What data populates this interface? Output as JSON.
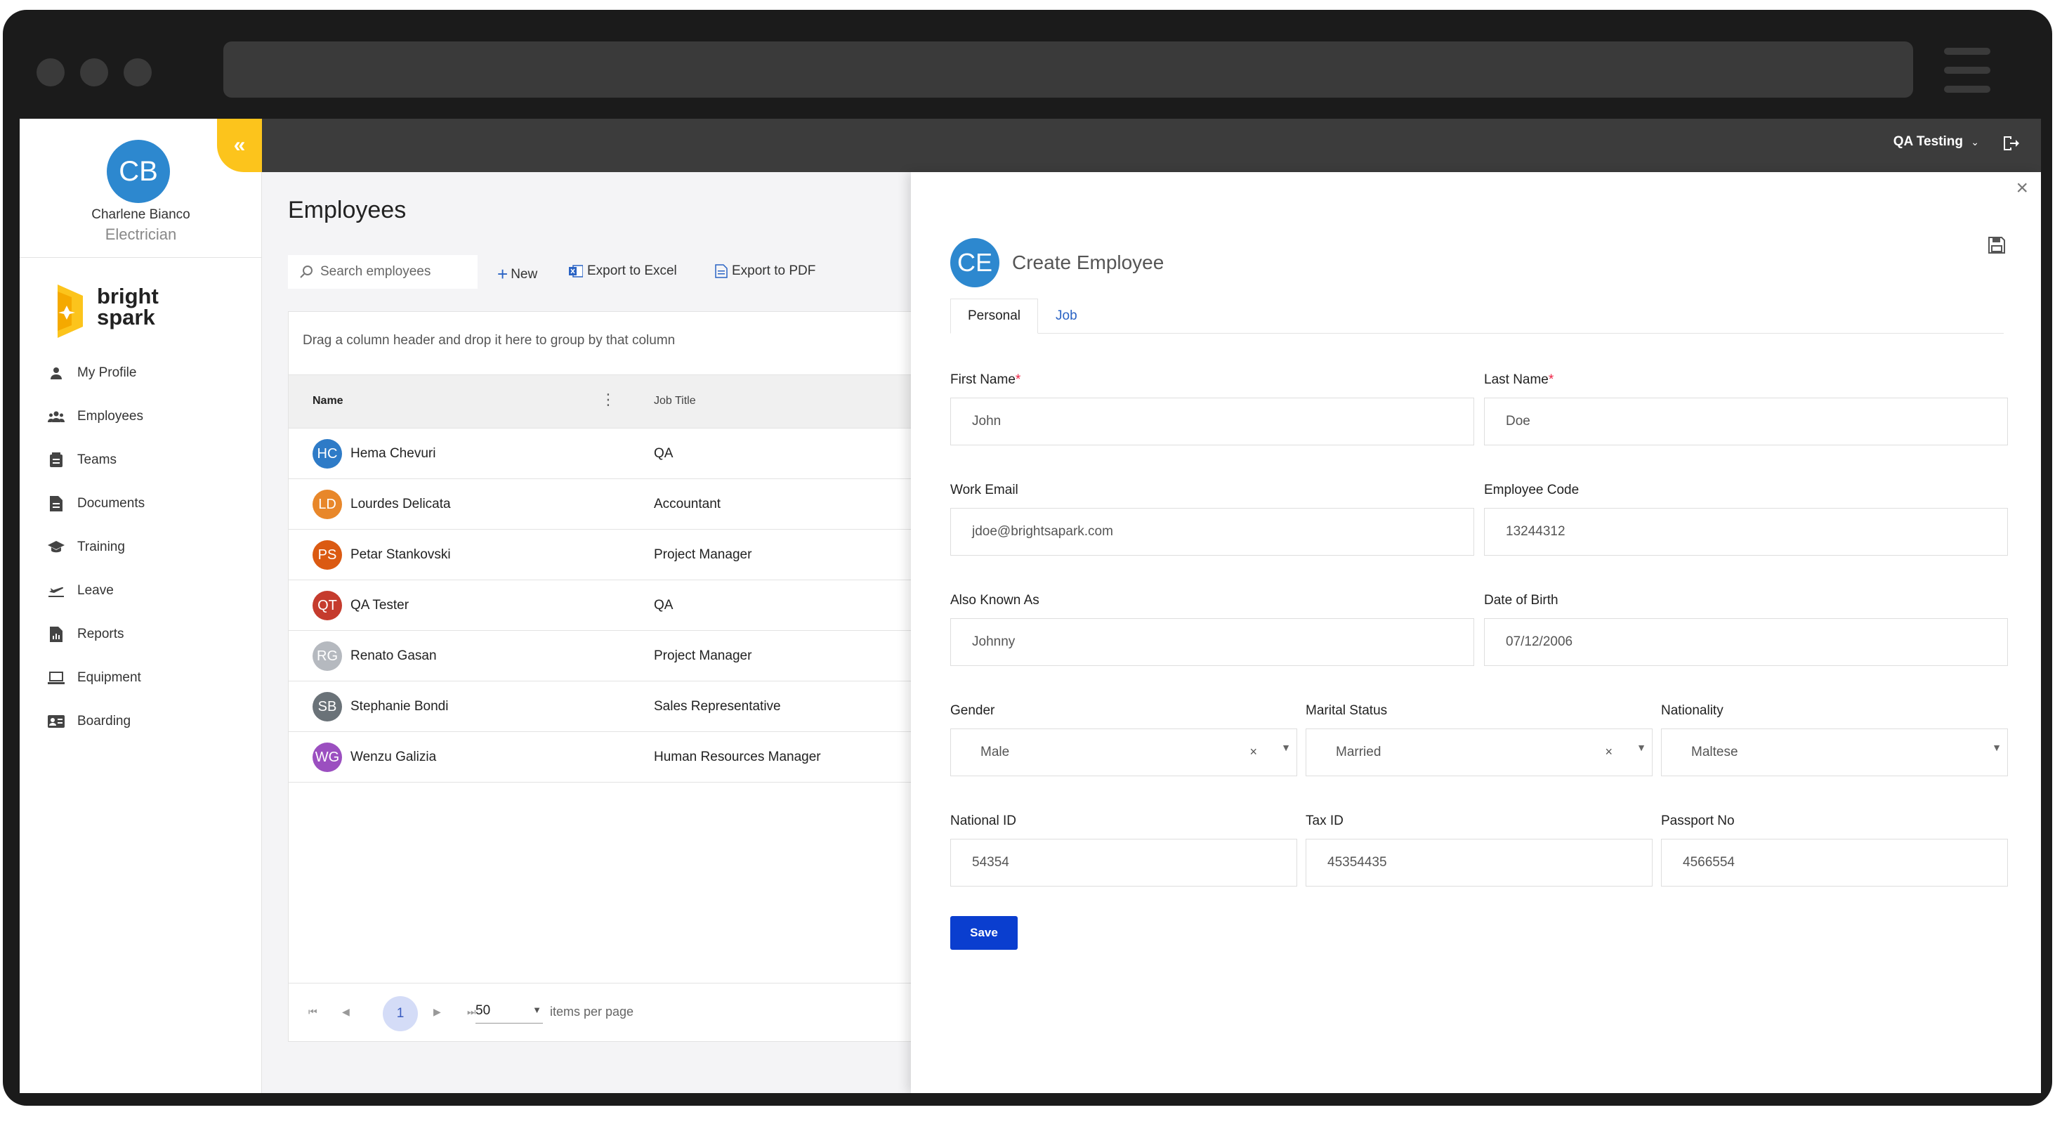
{
  "user": {
    "initials": "CB",
    "name": "Charlene Bianco",
    "role": "Electrician"
  },
  "logo": {
    "line1": "bright",
    "line2": "spark"
  },
  "nav": [
    {
      "label": "My Profile",
      "icon": "person-icon"
    },
    {
      "label": "Employees",
      "icon": "people-icon"
    },
    {
      "label": "Teams",
      "icon": "teams-icon"
    },
    {
      "label": "Documents",
      "icon": "document-icon"
    },
    {
      "label": "Training",
      "icon": "graduation-cap-icon"
    },
    {
      "label": "Leave",
      "icon": "plane-icon"
    },
    {
      "label": "Reports",
      "icon": "report-icon"
    },
    {
      "label": "Equipment",
      "icon": "laptop-icon"
    },
    {
      "label": "Boarding",
      "icon": "id-card-icon"
    }
  ],
  "collapse_glyph": "«",
  "topbar": {
    "org": "QA Testing"
  },
  "employees": {
    "title": "Employees",
    "search_placeholder": "Search employees",
    "toolbar": {
      "new": "New",
      "excel": "Export to Excel",
      "pdf": "Export to PDF"
    },
    "group_hint": "Drag a column header and drop it here to group by that column",
    "columns": [
      "Name",
      "Job Title"
    ],
    "rows": [
      {
        "initials": "HC",
        "name": "Hema Chevuri",
        "job": "QA",
        "color": "#2e7bc7"
      },
      {
        "initials": "LD",
        "name": "Lourdes Delicata",
        "job": "Accountant",
        "color": "#e8872a"
      },
      {
        "initials": "PS",
        "name": "Petar Stankovski",
        "job": "Project Manager",
        "color": "#db5a12"
      },
      {
        "initials": "QT",
        "name": "QA Tester",
        "job": "QA",
        "color": "#c53b2d"
      },
      {
        "initials": "RG",
        "name": "Renato Gasan",
        "job": "Project Manager",
        "color": "#b5b9bf"
      },
      {
        "initials": "SB",
        "name": "Stephanie Bondi",
        "job": "Sales Representative",
        "color": "#6a7278"
      },
      {
        "initials": "WG",
        "name": "Wenzu Galizia",
        "job": "Human Resources Manager",
        "color": "#9b4fc0"
      }
    ],
    "pager": {
      "page": "1",
      "page_size": "50",
      "label": "items per page"
    }
  },
  "create": {
    "initials": "CE",
    "title": "Create Employee",
    "tabs": [
      "Personal",
      "Job"
    ],
    "fields": {
      "first_name": {
        "label": "First Name",
        "value": "John"
      },
      "last_name": {
        "label": "Last Name",
        "value": "Doe"
      },
      "work_email": {
        "label": "Work Email",
        "value": "jdoe@brightsapark.com"
      },
      "employee_code": {
        "label": "Employee Code",
        "value": "13244312"
      },
      "aka": {
        "label": "Also Known As",
        "value": "Johnny"
      },
      "dob": {
        "label": "Date of Birth",
        "value": "07/12/2006"
      },
      "gender": {
        "label": "Gender",
        "value": "Male"
      },
      "marital": {
        "label": "Marital Status",
        "value": "Married"
      },
      "nationality": {
        "label": "Nationality",
        "value": "Maltese"
      },
      "national_id": {
        "label": "National ID",
        "value": "54354"
      },
      "tax_id": {
        "label": "Tax ID",
        "value": "45354435"
      },
      "passport": {
        "label": "Passport No",
        "value": "4566554"
      }
    },
    "save": "Save"
  }
}
